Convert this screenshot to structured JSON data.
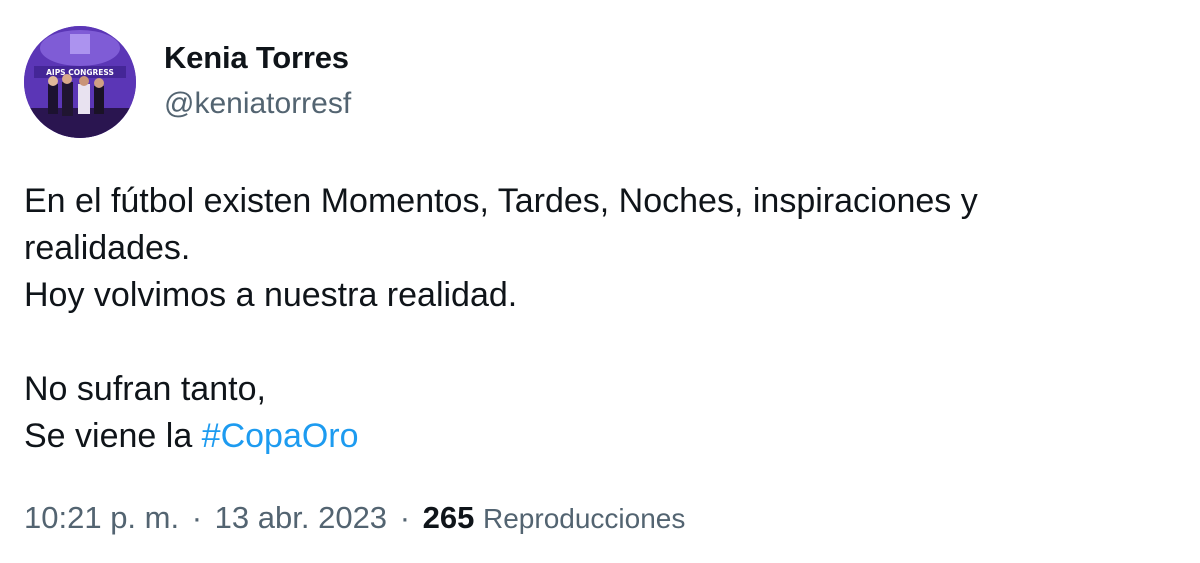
{
  "author": {
    "display_name": "Kenia Torres",
    "handle": "@keniatorresf",
    "avatar_text": "AIPS CONGRESS"
  },
  "tweet": {
    "lines": [
      "En el fútbol existen Momentos, Tardes, Noches, inspiraciones y",
      "realidades.",
      "Hoy volvimos a nuestra realidad.",
      "",
      "No sufran tanto,"
    ],
    "last_line_prefix": "Se viene la ",
    "hashtag": "#CopaOro"
  },
  "meta": {
    "time": "10:21 p. m.",
    "separator": "·",
    "date": "13 abr. 2023",
    "views_count": "265",
    "views_label": "Reproducciones"
  },
  "colors": {
    "text_primary": "#0f1419",
    "text_secondary": "#536471",
    "hashtag": "#1d9bf0",
    "avatar_bg": "#5a36b8"
  }
}
